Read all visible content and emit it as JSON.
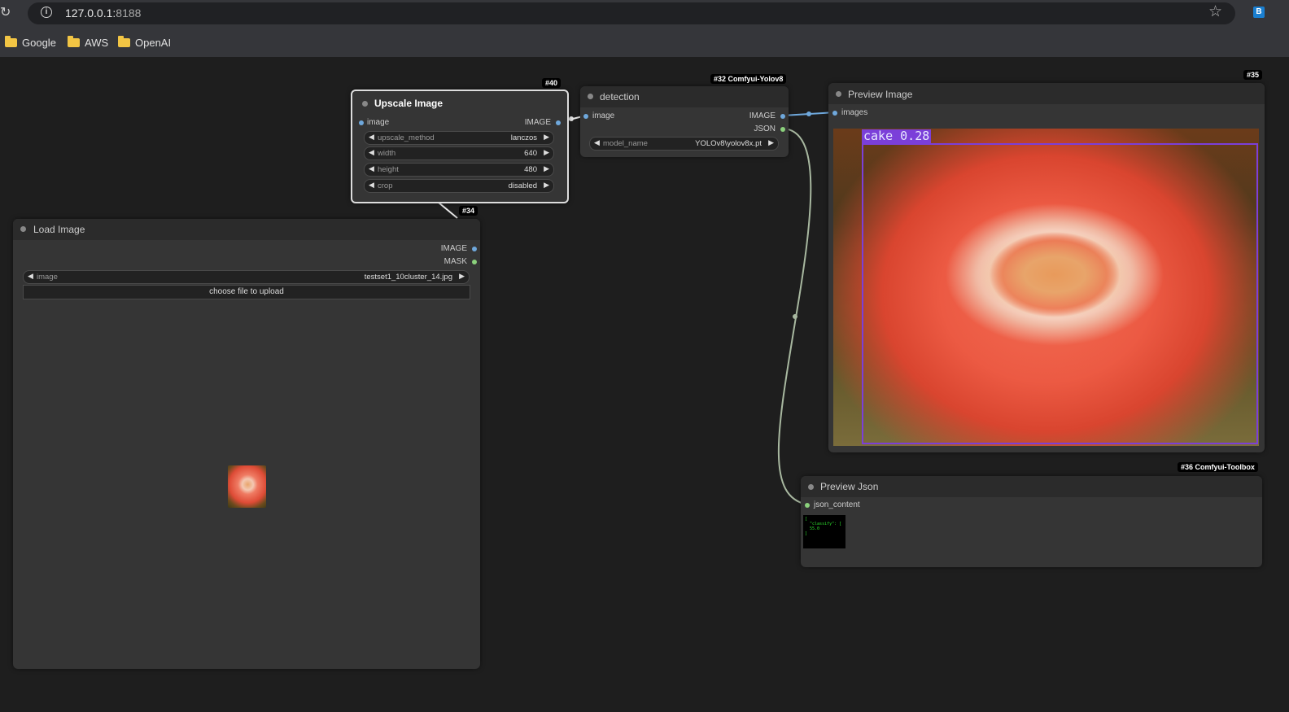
{
  "browser": {
    "url_host": "127.0.0.1:",
    "url_port": "8188",
    "bookmarks": [
      {
        "label": "Google",
        "icon": "folder-icon"
      },
      {
        "label": "AWS",
        "icon": "folder-icon"
      },
      {
        "label": "OpenAI",
        "icon": "folder-icon"
      }
    ]
  },
  "nodes": {
    "upscale": {
      "badge": "#40",
      "title": "Upscale Image",
      "input": "image",
      "output": "IMAGE",
      "widgets": [
        {
          "label": "upscale_method",
          "value": "lanczos"
        },
        {
          "label": "width",
          "value": "640"
        },
        {
          "label": "height",
          "value": "480"
        },
        {
          "label": "crop",
          "value": "disabled"
        }
      ]
    },
    "detection": {
      "badge": "#32 Comfyui-Yolov8",
      "title": "detection",
      "input": "image",
      "outputs": [
        "IMAGE",
        "JSON"
      ],
      "widget": {
        "label": "model_name",
        "value": "YOLOv8\\yolov8x.pt"
      }
    },
    "preview_image": {
      "badge": "#35",
      "title": "Preview Image",
      "input": "images",
      "detection_label": "cake 0.28"
    },
    "load_image": {
      "badge": "#34",
      "title": "Load Image",
      "outputs": [
        "IMAGE",
        "MASK"
      ],
      "widget": {
        "label": "image",
        "value": "testset1_10cluster_14.jpg"
      },
      "upload_label": "choose file to upload"
    },
    "preview_json": {
      "badge": "#36 Comfyui-Toolbox",
      "title": "Preview Json",
      "input": "json_content",
      "json_text": "[\n  \"classify\": [\n  55.0\n]"
    }
  },
  "colors": {
    "image_port": "#6fa8dc",
    "json_port": "#8bd17c",
    "bbox": "#7b3fd9",
    "canvas": "#1e1e1e",
    "node_body": "#353535"
  }
}
